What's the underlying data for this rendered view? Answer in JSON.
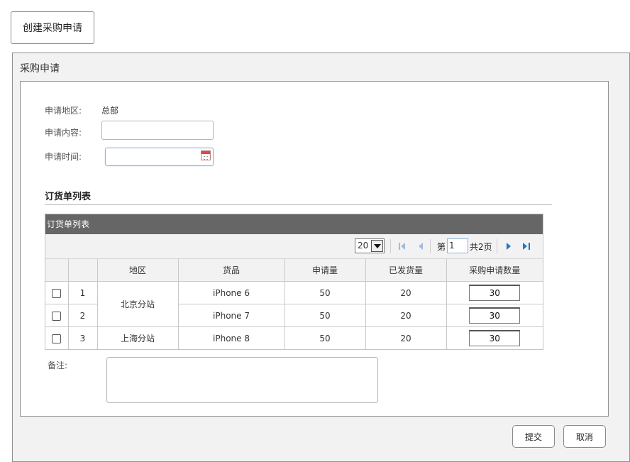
{
  "top": {
    "create_button": "创建采购申请"
  },
  "panel": {
    "title": "采购申请"
  },
  "form": {
    "region_label": "申请地区:",
    "region_value": "总部",
    "content_label": "申请内容:",
    "content_value": "",
    "time_label": "申请时间:",
    "time_value": ""
  },
  "section": {
    "title": "订货单列表"
  },
  "grid": {
    "title": "订货单列表",
    "pager": {
      "page_size": "20",
      "page_prefix": "第",
      "page_number": "1",
      "total_text": "共2页"
    },
    "columns": [
      "",
      "",
      "地区",
      "货品",
      "申请量",
      "已发货量",
      "采购申请数量"
    ],
    "rows": [
      {
        "num": "1",
        "region": "北京分站",
        "product": "iPhone 6",
        "requested": "50",
        "shipped": "20",
        "purchase_qty": "30"
      },
      {
        "num": "2",
        "region": "",
        "product": "iPhone 7",
        "requested": "50",
        "shipped": "20",
        "purchase_qty": "30"
      },
      {
        "num": "3",
        "region": "上海分站",
        "product": "iPhone 8",
        "requested": "50",
        "shipped": "20",
        "purchase_qty": "30"
      }
    ]
  },
  "notes": {
    "label": "备注:",
    "value": ""
  },
  "actions": {
    "submit": "提交",
    "cancel": "取消"
  }
}
